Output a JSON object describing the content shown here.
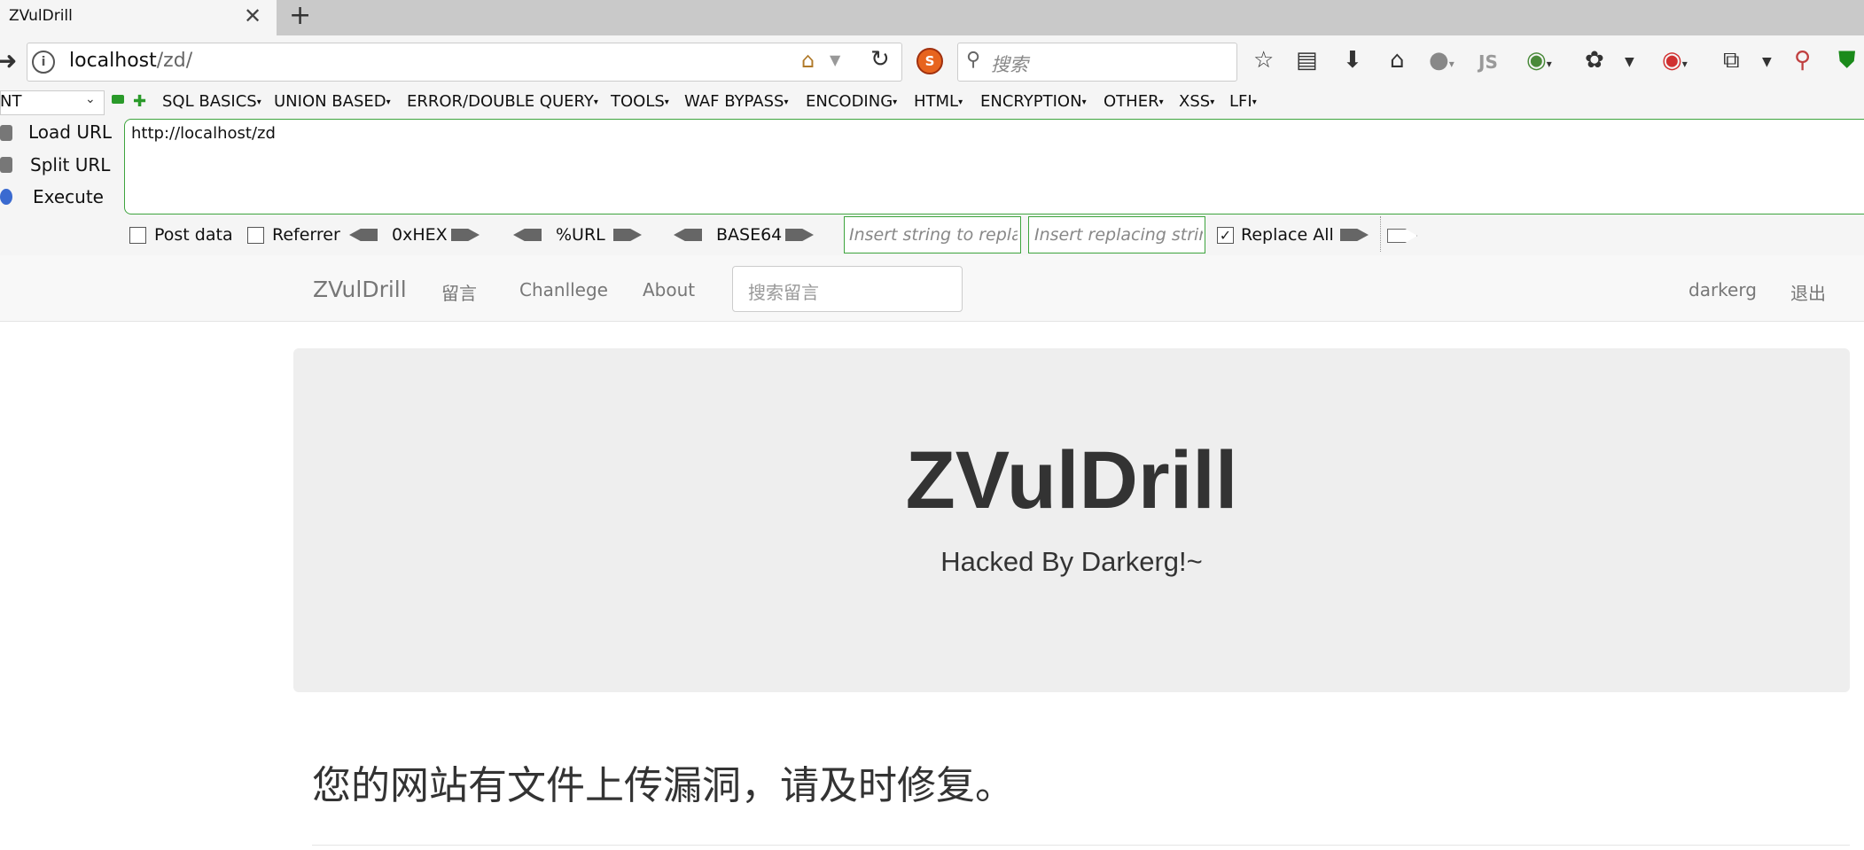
{
  "browser": {
    "tab_title": "ZVulDrill",
    "tab_close": "✕",
    "new_tab": "+",
    "url_host": "localhost",
    "url_path": "/zd/",
    "search_placeholder": "搜索"
  },
  "hackbar": {
    "select_value": "NT",
    "menus": [
      "SQL BASICS",
      "UNION BASED",
      "ERROR/DOUBLE QUERY",
      "TOOLS",
      "WAF BYPASS",
      "ENCODING",
      "HTML",
      "ENCRYPTION",
      "OTHER",
      "XSS",
      "LFI"
    ],
    "load_url": "Load URL",
    "split_url": "Split URL",
    "execute": "Execute",
    "url_value": "http://localhost/zd",
    "post_data": "Post data",
    "referrer": "Referrer",
    "hex": "0xHEX",
    "url_enc": "%URL",
    "base64": "BASE64",
    "replace_placeholder": "Insert string to replace",
    "replacing_placeholder": "Insert replacing string",
    "replace_all": "Replace All",
    "replace_all_checked": true
  },
  "site": {
    "brand": "ZVulDrill",
    "nav": [
      "留言",
      "Chanllege",
      "About"
    ],
    "search_placeholder": "搜索留言",
    "user": "darkerg",
    "logout": "退出",
    "jumbo_title": "ZVulDrill",
    "jumbo_subtitle": "Hacked By Darkerg!~",
    "notice": "您的网站有文件上传漏洞，请及时修复。"
  }
}
